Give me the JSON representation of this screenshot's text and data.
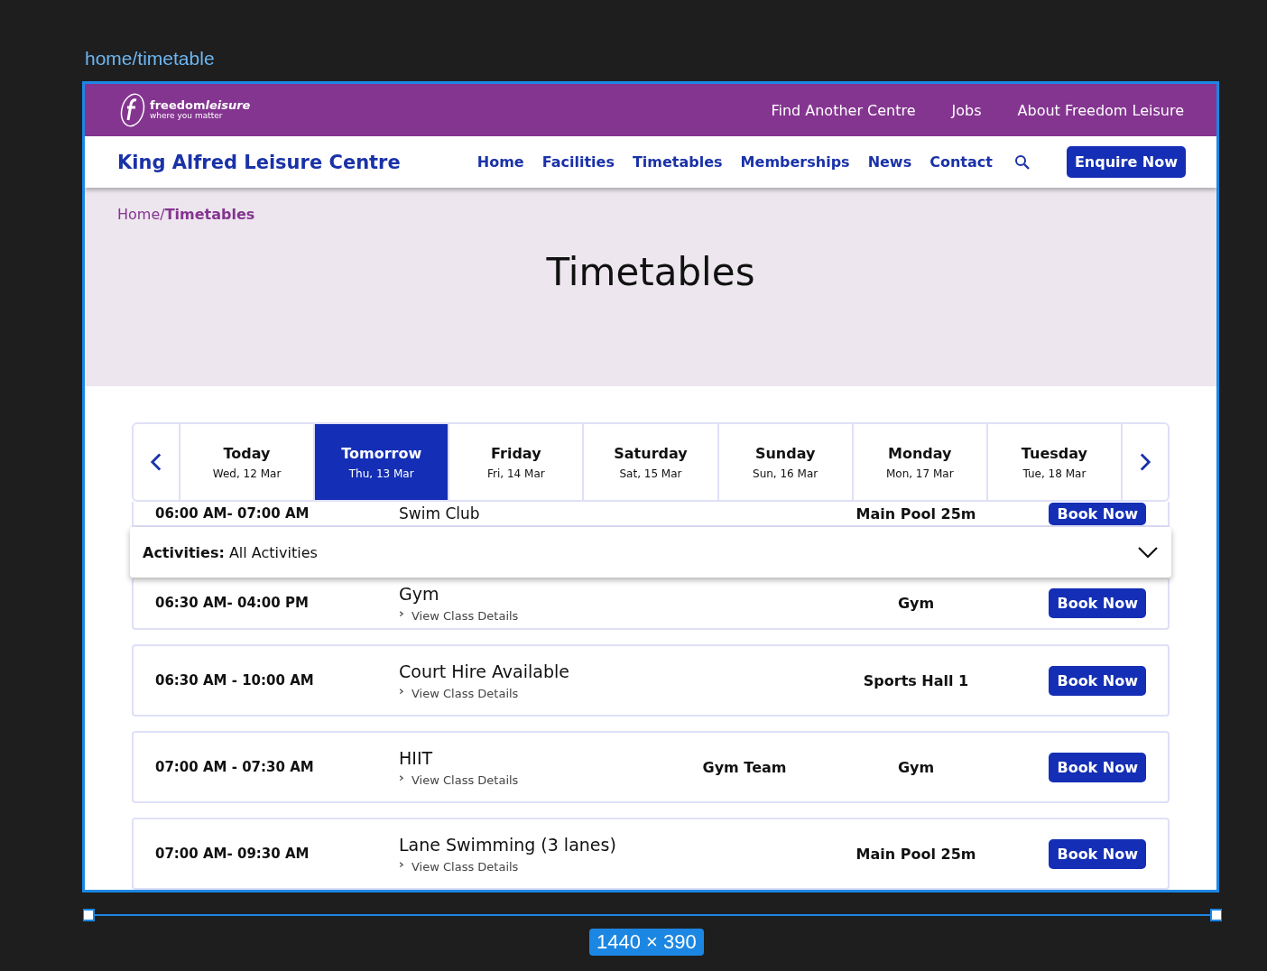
{
  "canvas": {
    "frame_label": "home/timetable",
    "size_badge": "1440 × 390"
  },
  "top_bar": {
    "logo": {
      "name": "freedom",
      "name_italic": "leisure",
      "tagline": "where you matter"
    },
    "links": [
      "Find Another Centre",
      "Jobs",
      "About Freedom Leisure"
    ]
  },
  "nav": {
    "site_title": "King Alfred Leisure Centre",
    "links": [
      "Home",
      "Facilities",
      "Timetables",
      "Memberships",
      "News",
      "Contact"
    ],
    "button": "Enquire Now"
  },
  "breadcrumb": {
    "parent": "Home/",
    "current": "Timetables"
  },
  "page_title": "Timetables",
  "days": [
    {
      "label": "Today",
      "date": "Wed, 12 Mar",
      "selected": false
    },
    {
      "label": "Tomorrow",
      "date": "Thu, 13 Mar",
      "selected": true
    },
    {
      "label": "Friday",
      "date": "Fri, 14 Mar",
      "selected": false
    },
    {
      "label": "Saturday",
      "date": "Sat, 15 Mar",
      "selected": false
    },
    {
      "label": "Sunday",
      "date": "Sun, 16 Mar",
      "selected": false
    },
    {
      "label": "Monday",
      "date": "Mon, 17 Mar",
      "selected": false
    },
    {
      "label": "Tuesday",
      "date": "Tue, 18 Mar",
      "selected": false
    }
  ],
  "filter": {
    "label": "Activities:",
    "value": "All Activities"
  },
  "sessions": [
    {
      "time": "06:00 AM- 07:00 AM",
      "title": "Swim Club",
      "location": "Main Pool 25m",
      "button": "Book Now"
    },
    {
      "time": "06:30 AM- 04:00 PM",
      "title": "Gym",
      "details_link": "View Class Details",
      "location": "Gym",
      "button": "Book Now"
    },
    {
      "time": "06:30 AM - 10:00 AM",
      "title": "Court Hire Available",
      "details_link": "View Class Details",
      "location": "Sports Hall 1",
      "button": "Book Now"
    },
    {
      "time": "07:00 AM - 07:30 AM",
      "title": "HIIT",
      "details_link": "View Class Details",
      "instructor": "Gym Team",
      "location": "Gym",
      "button": "Book Now"
    },
    {
      "time": "07:00 AM- 09:30 AM",
      "title": "Lane Swimming (3 lanes)",
      "details_link": "View Class Details",
      "location": "Main Pool 25m",
      "button": "Book Now"
    }
  ]
}
